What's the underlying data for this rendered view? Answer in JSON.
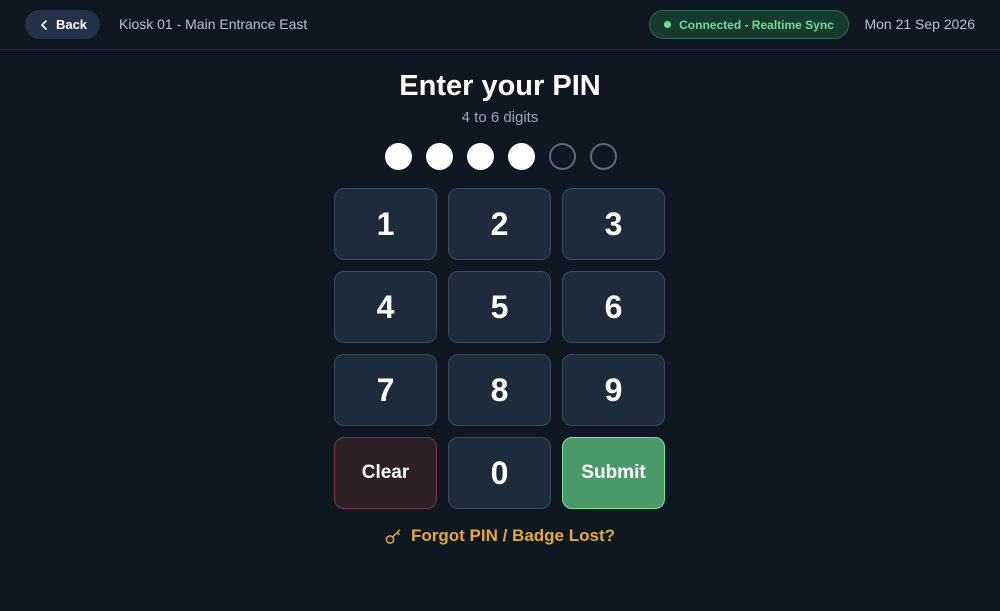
{
  "header": {
    "back_label": "Back",
    "kiosk_name": "Kiosk 01 - Main Entrance East",
    "status_label": "Connected - Realtime Sync",
    "date": "Mon 21 Sep 2026"
  },
  "pin": {
    "title": "Enter your PIN",
    "subtitle": "4 to 6 digits",
    "filled_count": 4,
    "max_length": 6
  },
  "keypad": {
    "keys": [
      "1",
      "2",
      "3",
      "4",
      "5",
      "6",
      "7",
      "8",
      "9"
    ],
    "clear_label": "Clear",
    "zero_label": "0",
    "submit_label": "Submit"
  },
  "footer": {
    "forgot_label": "Forgot PIN / Badge Lost?",
    "forgot_icon": "key-icon"
  },
  "colors": {
    "background": "#0f1723",
    "status_green": "#6fdc9a",
    "submit_green": "#4a9a69",
    "clear_red": "#7a3a40",
    "link_amber": "#e3a93b"
  }
}
